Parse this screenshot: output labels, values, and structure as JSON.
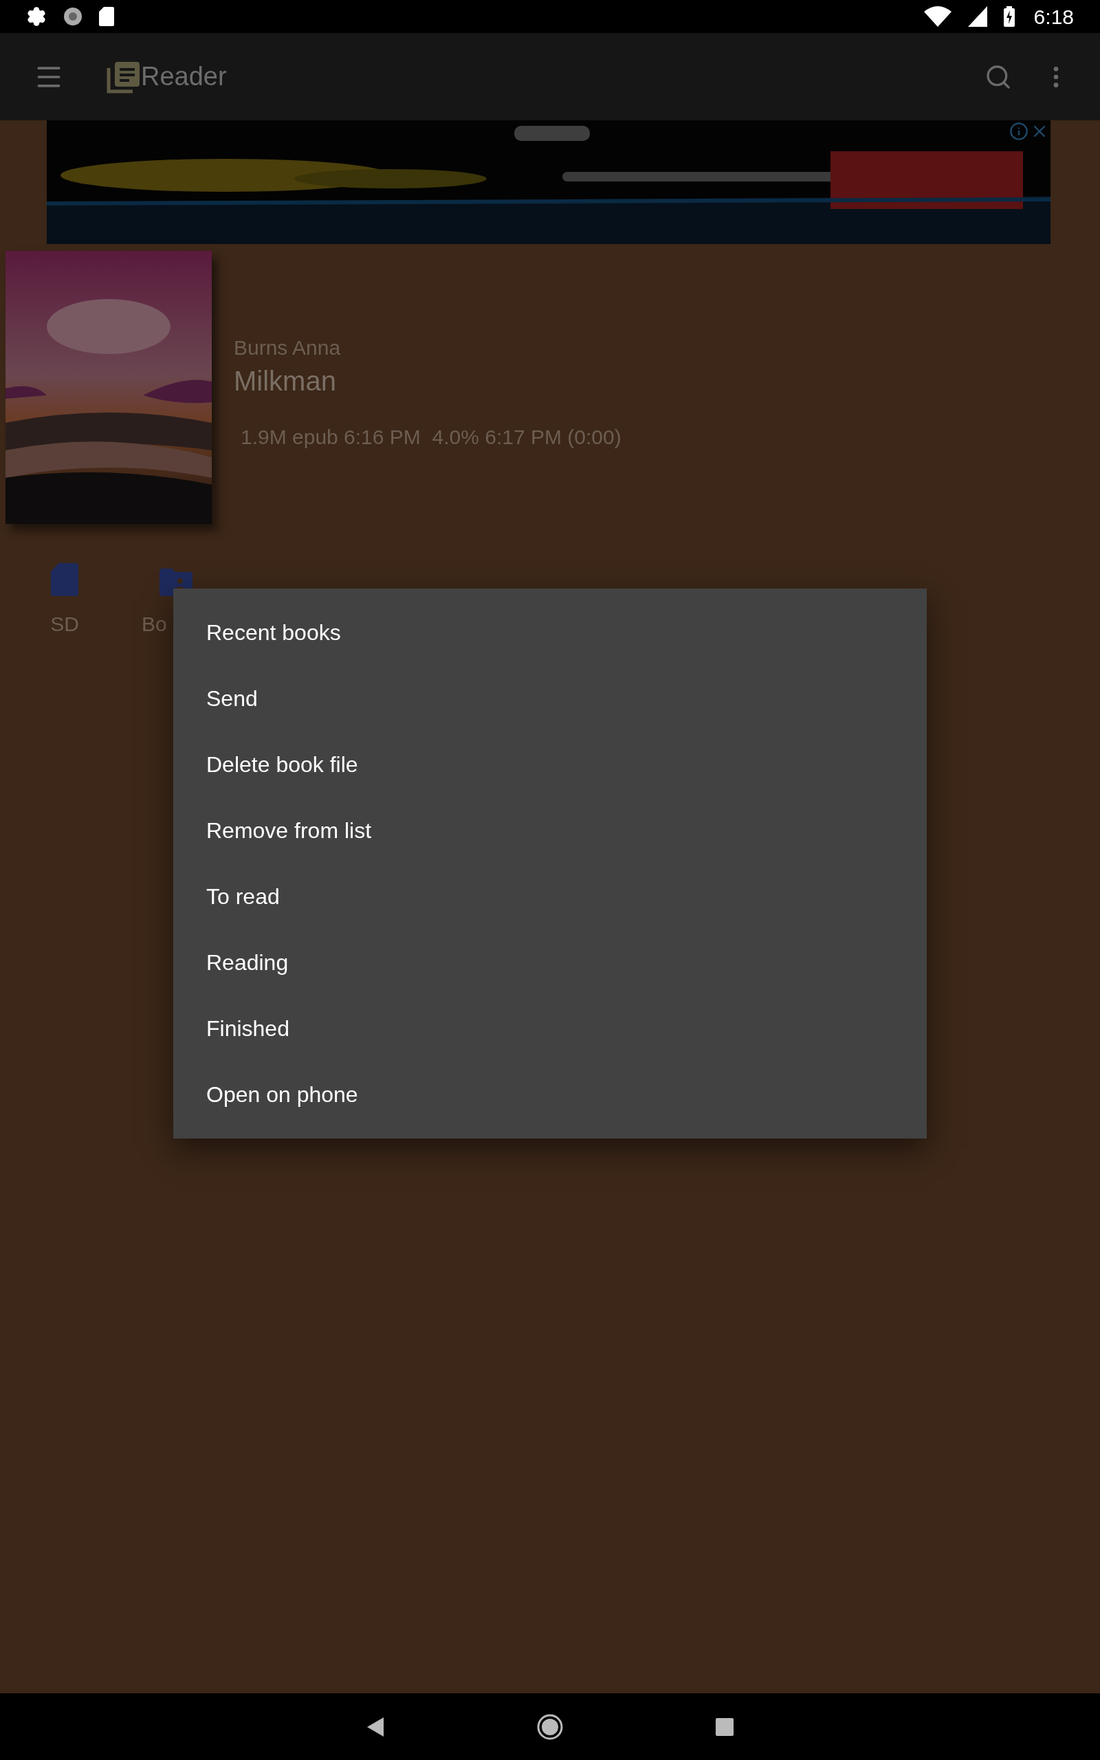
{
  "status_bar": {
    "time": "6:18"
  },
  "app_bar": {
    "title": "Reader"
  },
  "book": {
    "author": "Burns Anna",
    "title": "Milkman",
    "info": "1.9M epub 6:16 PM  4.0% 6:17 PM (0:00)"
  },
  "shortcuts": [
    {
      "kind": "sd",
      "label": "SD"
    },
    {
      "kind": "folder",
      "label": "Bo"
    }
  ],
  "menu": {
    "items": [
      "Recent books",
      "Send",
      "Delete book file",
      "Remove from list",
      "To read",
      "Reading",
      "Finished",
      "Open on phone"
    ]
  }
}
